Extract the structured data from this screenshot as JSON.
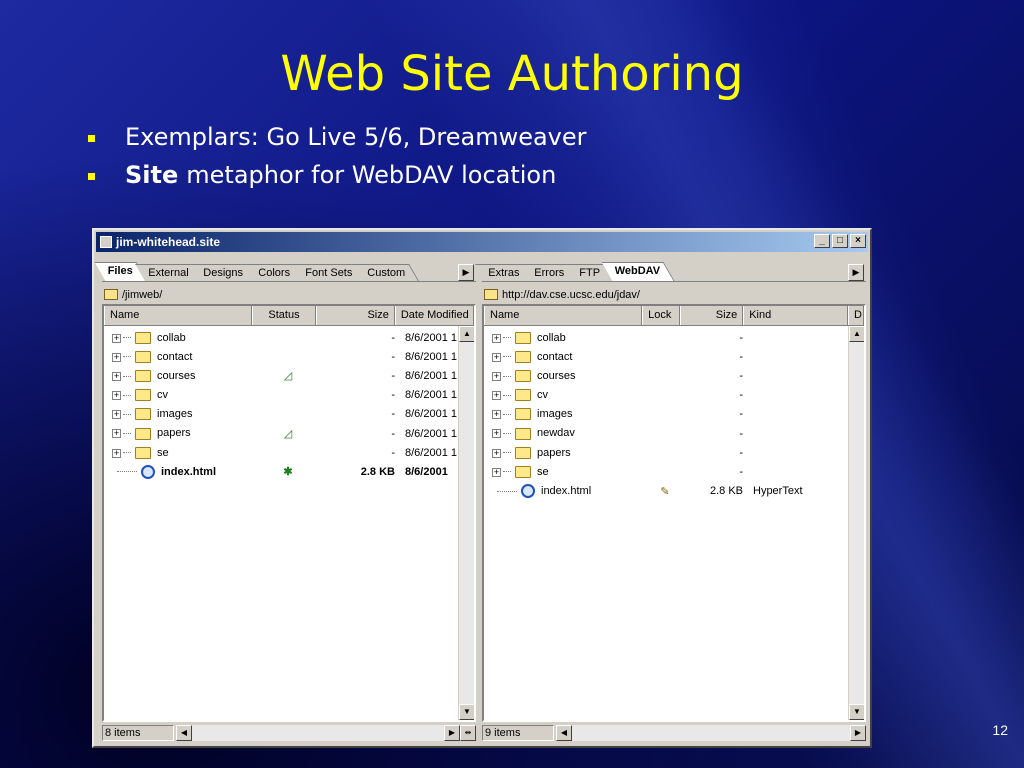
{
  "slide": {
    "title": "Web Site Authoring",
    "bullets": [
      {
        "bold": "",
        "text": "Exemplars: Go Live 5/6, Dreamweaver"
      },
      {
        "bold": "Site",
        "text": "metaphor for WebDAV location"
      }
    ],
    "page_number": "12",
    "colors": {
      "title": "#ffff00",
      "background": "#0c1480"
    }
  },
  "window": {
    "title": "jim-whitehead.site",
    "buttons": [
      "_",
      "□",
      "×"
    ]
  },
  "left_pane": {
    "tabs": [
      "Files",
      "External",
      "Designs",
      "Colors",
      "Font Sets",
      "Custom"
    ],
    "active_tab": "Files",
    "path": "/jimweb/",
    "columns": [
      "Name",
      "Status",
      "Size",
      "Date Modified"
    ],
    "rows": [
      {
        "type": "folder",
        "name": "collab",
        "status": "",
        "size": "-",
        "date": "8/6/2001 1"
      },
      {
        "type": "folder",
        "name": "contact",
        "status": "",
        "size": "-",
        "date": "8/6/2001 1"
      },
      {
        "type": "folder",
        "name": "courses",
        "status": "◿",
        "size": "-",
        "date": "8/6/2001 1"
      },
      {
        "type": "folder",
        "name": "cv",
        "status": "",
        "size": "-",
        "date": "8/6/2001 1"
      },
      {
        "type": "folder",
        "name": "images",
        "status": "",
        "size": "-",
        "date": "8/6/2001 1"
      },
      {
        "type": "folder",
        "name": "papers",
        "status": "◿",
        "size": "-",
        "date": "8/6/2001 1"
      },
      {
        "type": "folder",
        "name": "se",
        "status": "",
        "size": "-",
        "date": "8/6/2001 1"
      },
      {
        "type": "file",
        "name": "index.html",
        "status": "✱",
        "size": "2.8 KB",
        "date": "8/6/2001"
      }
    ],
    "item_count": "8 items"
  },
  "right_pane": {
    "tabs": [
      "Extras",
      "Errors",
      "FTP",
      "WebDAV"
    ],
    "active_tab": "WebDAV",
    "path": "http://dav.cse.ucsc.edu/jdav/",
    "columns": [
      "Name",
      "Lock",
      "Size",
      "Kind",
      "D"
    ],
    "rows": [
      {
        "type": "folder",
        "name": "collab",
        "lock": "",
        "size": "-",
        "kind": ""
      },
      {
        "type": "folder",
        "name": "contact",
        "lock": "",
        "size": "-",
        "kind": ""
      },
      {
        "type": "folder",
        "name": "courses",
        "lock": "",
        "size": "-",
        "kind": ""
      },
      {
        "type": "folder",
        "name": "cv",
        "lock": "",
        "size": "-",
        "kind": ""
      },
      {
        "type": "folder",
        "name": "images",
        "lock": "",
        "size": "-",
        "kind": ""
      },
      {
        "type": "folder",
        "name": "newdav",
        "lock": "",
        "size": "-",
        "kind": ""
      },
      {
        "type": "folder",
        "name": "papers",
        "lock": "",
        "size": "-",
        "kind": ""
      },
      {
        "type": "folder",
        "name": "se",
        "lock": "",
        "size": "-",
        "kind": ""
      },
      {
        "type": "file",
        "name": "index.html",
        "lock": "✎",
        "size": "2.8 KB",
        "kind": "HyperText"
      }
    ],
    "item_count": "9 items"
  }
}
